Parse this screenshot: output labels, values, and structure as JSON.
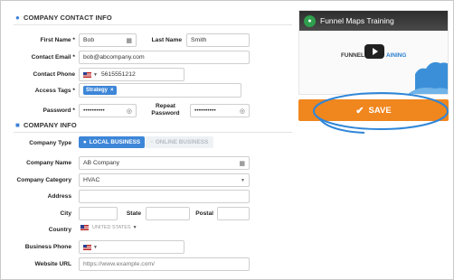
{
  "contact": {
    "section_title": "COMPANY CONTACT INFO",
    "first_name_label": "First Name *",
    "first_name": "Bob",
    "last_name_label": "Last Name",
    "last_name": "Smith",
    "email_label": "Contact Email *",
    "email": "bob@abcompany.com",
    "phone_label": "Contact Phone",
    "phone": "5615551212",
    "tags_label": "Access Tags *",
    "tag": "Strategy",
    "password_label": "Password *",
    "password": "••••••••••",
    "repeat_password_label": "Repeat Password",
    "repeat_password": "••••••••••"
  },
  "company": {
    "section_title": "COMPANY INFO",
    "type_label": "Company Type",
    "type_local": "LOCAL BUSINESS",
    "type_online": "ONLINE BUSINESS",
    "name_label": "Company Name",
    "name": "AB Company",
    "category_label": "Company Category",
    "category": "HVAC",
    "address_label": "Address",
    "city_label": "City",
    "state_label": "State",
    "postal_label": "Postal",
    "country_label": "Country",
    "country": "UNITED STATES",
    "business_phone_label": "Business Phone",
    "website_label": "Website URL",
    "website_placeholder": "https://www.example.com/"
  },
  "video": {
    "title": "Funnel Maps Training",
    "brand_left": "FUNNEL",
    "brand_right": "AINING"
  },
  "save_label": "SAVE",
  "colors": {
    "accent_blue": "#3d86d8",
    "save_orange": "#f0861e",
    "highlight_circle": "#2f86d8"
  }
}
